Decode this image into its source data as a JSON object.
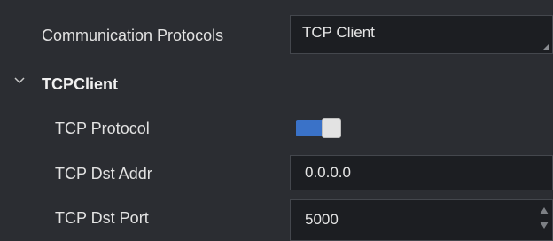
{
  "communication": {
    "label": "Communication Protocols",
    "selected": "TCP Client",
    "corner_icon": "resize-grip-icon"
  },
  "section": {
    "title": "TCPClient",
    "expanded": true,
    "chevron_icon": "chevron-down-icon"
  },
  "tcp_protocol": {
    "label": "TCP Protocol",
    "enabled": true,
    "accent_color": "#3a72c8"
  },
  "dst_addr": {
    "label": "TCP Dst Addr",
    "value": "0.0.0.0"
  },
  "dst_port": {
    "label": "TCP Dst Port",
    "value": "5000",
    "spin_icons": [
      "spin-up-icon",
      "spin-down-icon"
    ]
  }
}
